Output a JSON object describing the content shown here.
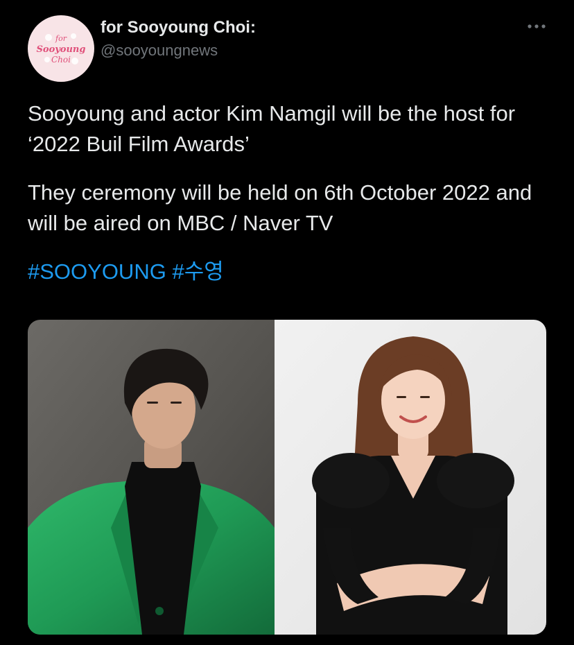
{
  "tweet": {
    "avatar": {
      "logo_text": [
        "for",
        "Sooyoung",
        "Choi"
      ],
      "background": "#f8e4e7",
      "ink": "#e0507a"
    },
    "author_name": "for Sooyoung Choi:",
    "author_handle": "@sooyoungnews",
    "more_icon": "more-horizontal-icon",
    "paragraphs": [
      "Sooyoung and actor Kim Namgil will be the host for ‘2022 Buil Film Awards’",
      "They ceremony will be held on 6th October 2022 and will be aired on MBC / Naver TV"
    ],
    "hashtags": [
      "#SOOYOUNG",
      "#수영"
    ]
  },
  "colors": {
    "background": "#000000",
    "text": "#e7e9ea",
    "muted": "#71767b",
    "link": "#1d9bf0",
    "jacket_green": "#1f9a55"
  }
}
